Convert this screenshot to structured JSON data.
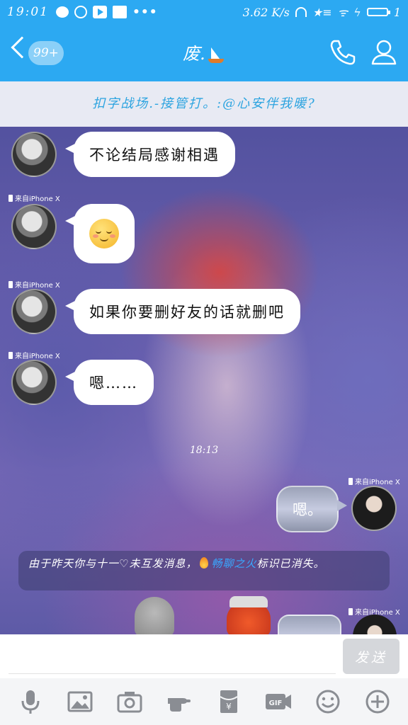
{
  "status_bar": {
    "time": "19:01",
    "more": "•••",
    "network_speed": "3.62 K/s",
    "battery_text": "1"
  },
  "header": {
    "unread_count": "99+",
    "title": "废."
  },
  "notice": {
    "text": "扣字战场.-接管打。:@心安伴我暖?"
  },
  "messages": [
    {
      "side": "left",
      "device": "来自iPhone X",
      "text": "不论结局感谢相遇"
    },
    {
      "side": "left",
      "device": "来自iPhone X",
      "emoji": "smiley"
    },
    {
      "side": "left",
      "device": "来自iPhone X",
      "text": "如果你要删好友的话就删吧"
    },
    {
      "side": "left",
      "device": "来自iPhone X",
      "text": "嗯……"
    }
  ],
  "timestamp": "18:13",
  "reply": {
    "device": "来自iPhone X",
    "text": "嗯。"
  },
  "system_message": {
    "prefix": "由于昨天你与十一♡未互发消息，",
    "feature": "畅聊之火",
    "suffix": "标识已消失。"
  },
  "last_message": {
    "device": "来自iPhone X"
  },
  "input": {
    "placeholder": "",
    "send_label": "发送"
  },
  "toolbar": {
    "items": [
      "mic-icon",
      "image-icon",
      "camera-icon",
      "poke-icon",
      "red-packet-icon",
      "gif-icon",
      "emoji-icon",
      "plus-icon"
    ],
    "gif_label": "GIF"
  },
  "colors": {
    "brand_blue": "#2ca9f2",
    "notice_text": "#2da4e0",
    "highlight": "#39a8ff"
  }
}
